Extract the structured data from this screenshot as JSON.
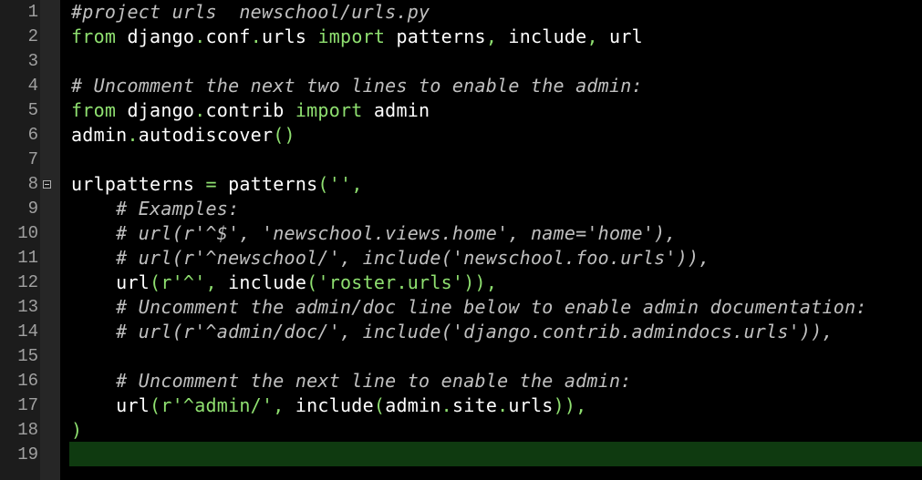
{
  "editor": {
    "current_line": 19,
    "fold_marker_line": 8,
    "colors": {
      "background": "#000000",
      "gutter": "#1c1c1c",
      "keyword": "#8fe070",
      "comment": "#c0c0c0",
      "identifier": "#ffffff",
      "current_line": "#0f3a10"
    },
    "lines": [
      {
        "n": "1",
        "tokens": [
          {
            "t": "cm",
            "v": "#project urls  newschool/urls.py"
          }
        ]
      },
      {
        "n": "2",
        "tokens": [
          {
            "t": "kw",
            "v": "from"
          },
          {
            "t": "id",
            "v": " django"
          },
          {
            "t": "pn",
            "v": "."
          },
          {
            "t": "id",
            "v": "conf"
          },
          {
            "t": "pn",
            "v": "."
          },
          {
            "t": "id",
            "v": "urls "
          },
          {
            "t": "kw",
            "v": "import"
          },
          {
            "t": "id",
            "v": " patterns"
          },
          {
            "t": "pn",
            "v": ","
          },
          {
            "t": "id",
            "v": " include"
          },
          {
            "t": "pn",
            "v": ","
          },
          {
            "t": "id",
            "v": " url"
          }
        ]
      },
      {
        "n": "3",
        "tokens": []
      },
      {
        "n": "4",
        "tokens": [
          {
            "t": "cm",
            "v": "# Uncomment the next two lines to enable the admin:"
          }
        ]
      },
      {
        "n": "5",
        "tokens": [
          {
            "t": "kw",
            "v": "from"
          },
          {
            "t": "id",
            "v": " django"
          },
          {
            "t": "pn",
            "v": "."
          },
          {
            "t": "id",
            "v": "contrib "
          },
          {
            "t": "kw",
            "v": "import"
          },
          {
            "t": "id",
            "v": " admin"
          }
        ]
      },
      {
        "n": "6",
        "tokens": [
          {
            "t": "id",
            "v": "admin"
          },
          {
            "t": "pn",
            "v": "."
          },
          {
            "t": "id",
            "v": "autodiscover"
          },
          {
            "t": "pn",
            "v": "()"
          }
        ]
      },
      {
        "n": "7",
        "tokens": []
      },
      {
        "n": "8",
        "tokens": [
          {
            "t": "id",
            "v": "urlpatterns "
          },
          {
            "t": "pn",
            "v": "="
          },
          {
            "t": "id",
            "v": " patterns"
          },
          {
            "t": "pn",
            "v": "("
          },
          {
            "t": "str",
            "v": "''"
          },
          {
            "t": "pn",
            "v": ","
          }
        ]
      },
      {
        "n": "9",
        "tokens": [
          {
            "t": "id",
            "v": "    "
          },
          {
            "t": "cm",
            "v": "# Examples:"
          }
        ]
      },
      {
        "n": "10",
        "tokens": [
          {
            "t": "id",
            "v": "    "
          },
          {
            "t": "cm",
            "v": "# url(r'^$', 'newschool.views.home', name='home'),"
          }
        ]
      },
      {
        "n": "11",
        "tokens": [
          {
            "t": "id",
            "v": "    "
          },
          {
            "t": "cm",
            "v": "# url(r'^newschool/', include('newschool.foo.urls')),"
          }
        ]
      },
      {
        "n": "12",
        "tokens": [
          {
            "t": "id",
            "v": "    url"
          },
          {
            "t": "pn",
            "v": "("
          },
          {
            "t": "str",
            "v": "r'^'"
          },
          {
            "t": "pn",
            "v": ","
          },
          {
            "t": "id",
            "v": " include"
          },
          {
            "t": "pn",
            "v": "("
          },
          {
            "t": "str",
            "v": "'roster.urls'"
          },
          {
            "t": "pn",
            "v": ")),"
          }
        ]
      },
      {
        "n": "13",
        "tokens": [
          {
            "t": "id",
            "v": "    "
          },
          {
            "t": "cm",
            "v": "# Uncomment the admin/doc line below to enable admin documentation:"
          }
        ]
      },
      {
        "n": "14",
        "tokens": [
          {
            "t": "id",
            "v": "    "
          },
          {
            "t": "cm",
            "v": "# url(r'^admin/doc/', include('django.contrib.admindocs.urls')),"
          }
        ]
      },
      {
        "n": "15",
        "tokens": []
      },
      {
        "n": "16",
        "tokens": [
          {
            "t": "id",
            "v": "    "
          },
          {
            "t": "cm",
            "v": "# Uncomment the next line to enable the admin:"
          }
        ]
      },
      {
        "n": "17",
        "tokens": [
          {
            "t": "id",
            "v": "    url"
          },
          {
            "t": "pn",
            "v": "("
          },
          {
            "t": "str",
            "v": "r'^admin/'"
          },
          {
            "t": "pn",
            "v": ","
          },
          {
            "t": "id",
            "v": " include"
          },
          {
            "t": "pn",
            "v": "("
          },
          {
            "t": "id",
            "v": "admin"
          },
          {
            "t": "pn",
            "v": "."
          },
          {
            "t": "id",
            "v": "site"
          },
          {
            "t": "pn",
            "v": "."
          },
          {
            "t": "id",
            "v": "urls"
          },
          {
            "t": "pn",
            "v": ")),"
          }
        ]
      },
      {
        "n": "18",
        "tokens": [
          {
            "t": "pn",
            "v": ")"
          }
        ]
      },
      {
        "n": "19",
        "tokens": []
      }
    ]
  }
}
